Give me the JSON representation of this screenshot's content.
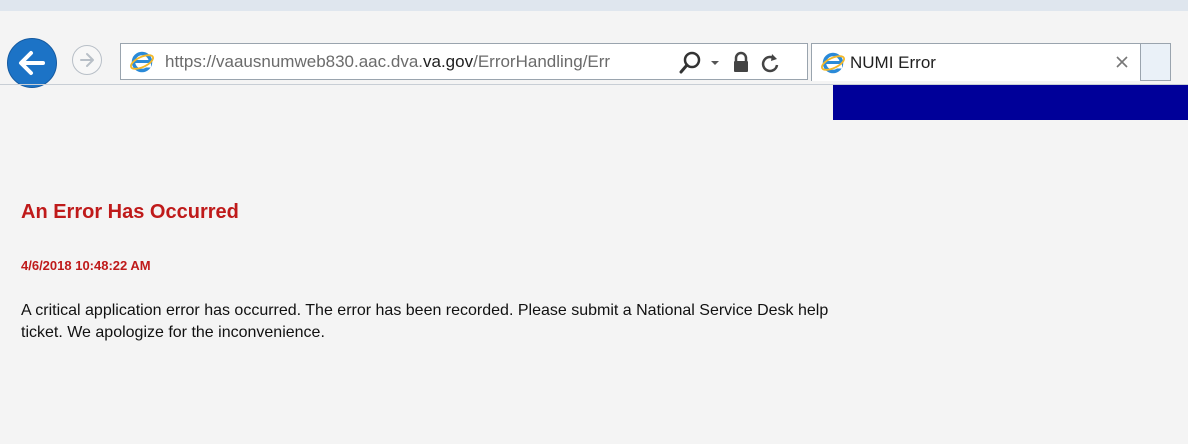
{
  "browser": {
    "url": {
      "prefix": "https://vaausnumweb830.aac.dva.",
      "domain": "va.gov",
      "path": "/ErrorHandling/Err"
    },
    "tab": {
      "title": "NUMI Error"
    },
    "icons": {
      "back": "arrow-left-icon",
      "forward": "arrow-right-icon",
      "page": "internet-explorer-icon",
      "search": "search-icon",
      "dropdown": "chevron-down-icon",
      "lock": "lock-icon",
      "refresh": "refresh-icon",
      "close": "close-icon"
    },
    "colors": {
      "accent": "#1c73c6"
    }
  },
  "page": {
    "banner_color": "#000099",
    "error": {
      "title": "An Error Has Occurred",
      "timestamp": "4/6/2018 10:48:22 AM",
      "message": "A critical application error has occurred. The error has been recorded. Please submit a National Service Desk help ticket. We apologize for the inconvenience.",
      "color": "#bf1a1a"
    }
  }
}
